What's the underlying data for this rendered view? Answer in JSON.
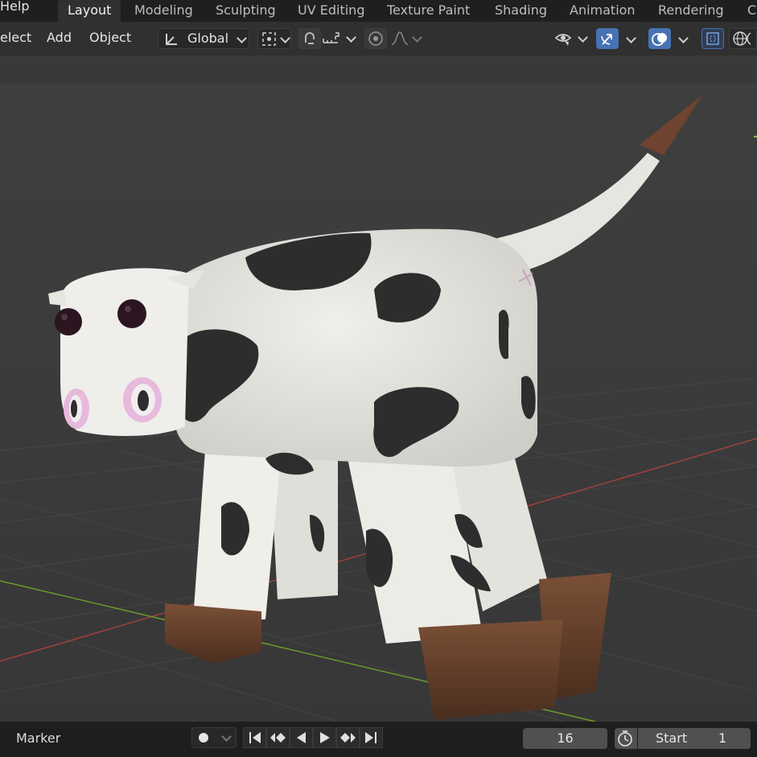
{
  "topbar": {
    "help": "Help",
    "tabs": [
      {
        "label": "Layout"
      },
      {
        "label": "Modeling"
      },
      {
        "label": "Sculpting"
      },
      {
        "label": "UV Editing"
      },
      {
        "label": "Texture Paint"
      },
      {
        "label": "Shading"
      },
      {
        "label": "Animation"
      },
      {
        "label": "Rendering"
      },
      {
        "label": "C"
      }
    ]
  },
  "header": {
    "select": "elect",
    "add": "Add",
    "object": "Object",
    "orientation": "Global"
  },
  "timeline": {
    "marker": "Marker",
    "current_frame": "16",
    "start_label": "Start",
    "start_value": "1"
  },
  "colors": {
    "accent": "#4772b3",
    "topbar_bg": "#1f1f1f",
    "viewport_bg": "#3d3d3d",
    "x_axis": "#a0413f",
    "y_axis": "#6a9a2a"
  },
  "icons": [
    "transform-orientation-icon",
    "pivot-icon",
    "snap-magnet-icon",
    "snap-increment-icon",
    "proportional-edit-icon",
    "falloff-icon",
    "visibility-icon",
    "gizmo-icon",
    "overlay-icon",
    "xray-icon",
    "wireframe-icon",
    "record-icon",
    "jump-start-icon",
    "prev-keyframe-icon",
    "play-reverse-icon",
    "play-icon",
    "next-keyframe-icon",
    "jump-end-icon",
    "clock-icon"
  ]
}
